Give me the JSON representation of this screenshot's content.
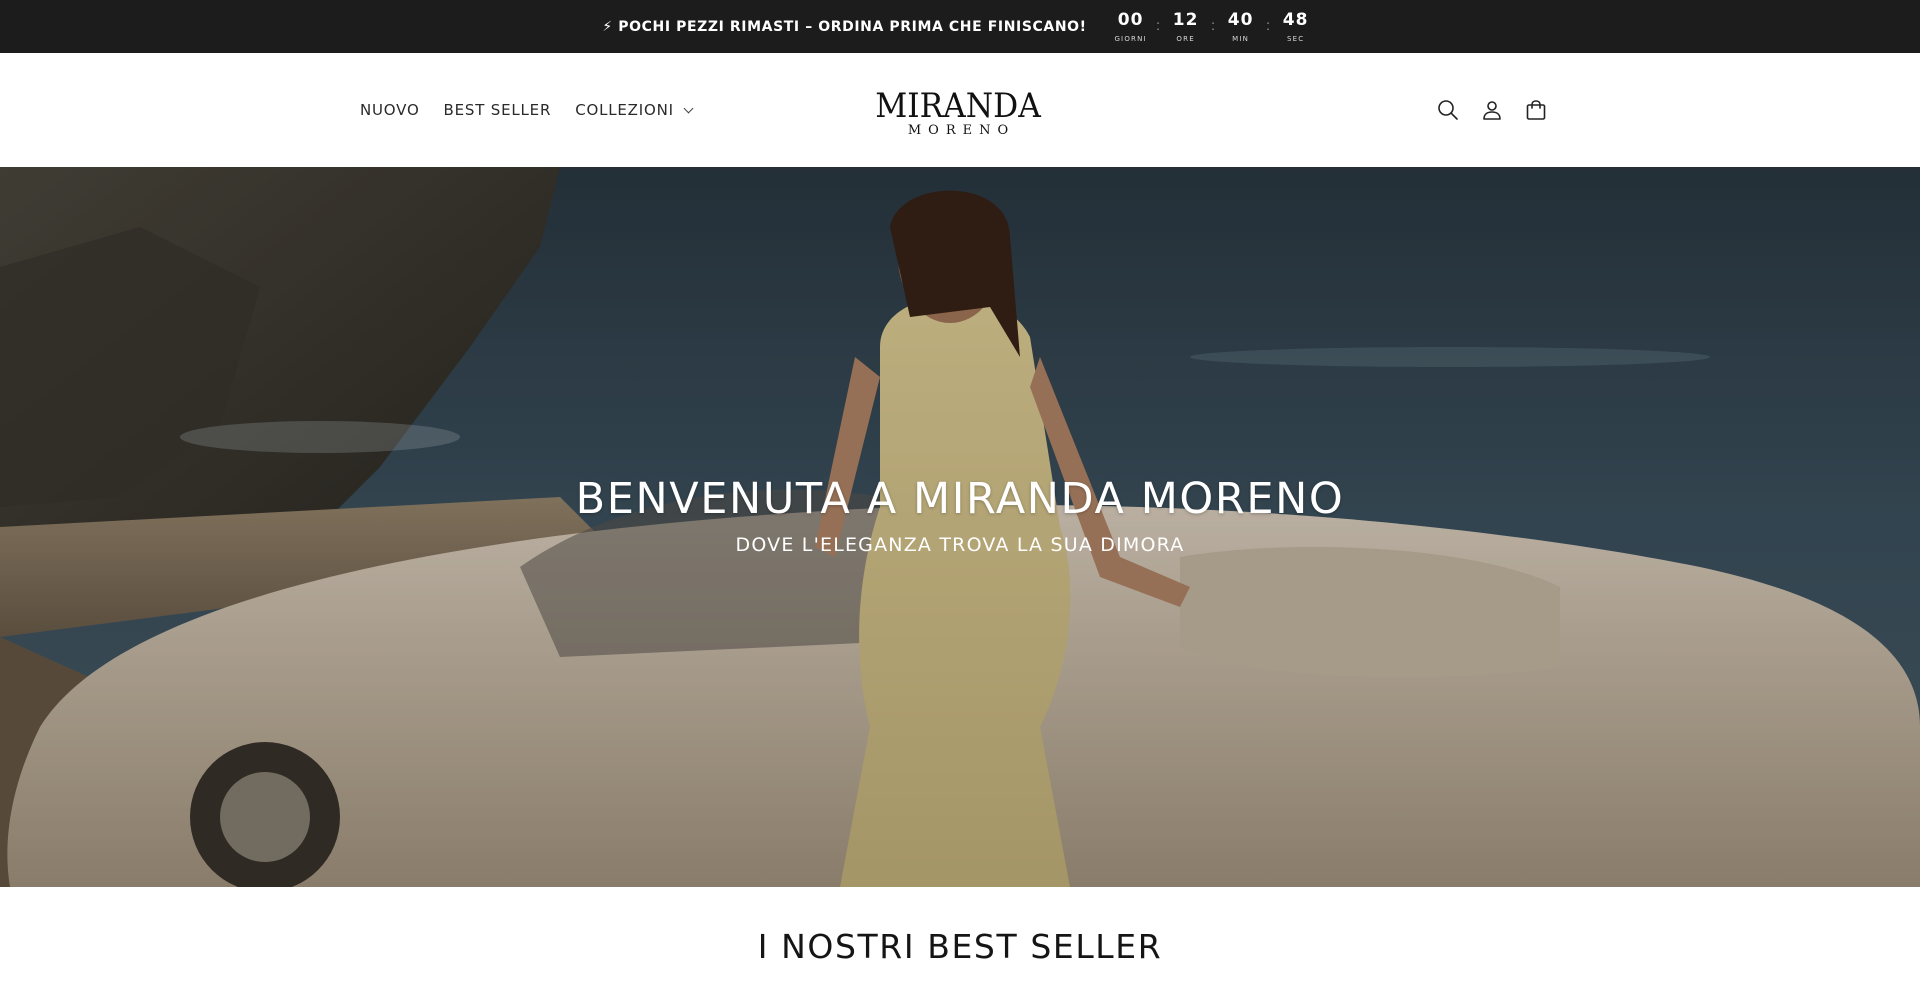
{
  "announcement": {
    "icon": "lightning-icon",
    "text": "⚡ POCHI PEZZI RIMASTI – ORDINA PRIMA CHE FINISCANO!",
    "countdown": [
      {
        "value": "00",
        "label": "GIORNI"
      },
      {
        "value": "12",
        "label": "ORE"
      },
      {
        "value": "40",
        "label": "MIN"
      },
      {
        "value": "48",
        "label": "SEC"
      }
    ],
    "separator": ":"
  },
  "nav": {
    "items": [
      {
        "label": "NUOVO"
      },
      {
        "label": "BEST SELLER"
      },
      {
        "label": "COLLEZIONI"
      }
    ]
  },
  "logo": {
    "main": "MIRANDA",
    "sub": "MORENO"
  },
  "header_icons": [
    "search-icon",
    "account-icon",
    "cart-icon"
  ],
  "hero": {
    "title": "BENVENUTA A MIRANDA MORENO",
    "subtitle": "DOVE L'ELEGANZA TROVA LA SUA DIMORA"
  },
  "bestseller": {
    "title": "I NOSTRI BEST SELLER"
  },
  "colors": {
    "announcement_bg": "#1c1c1c",
    "text_dark": "#121212",
    "white": "#ffffff"
  }
}
